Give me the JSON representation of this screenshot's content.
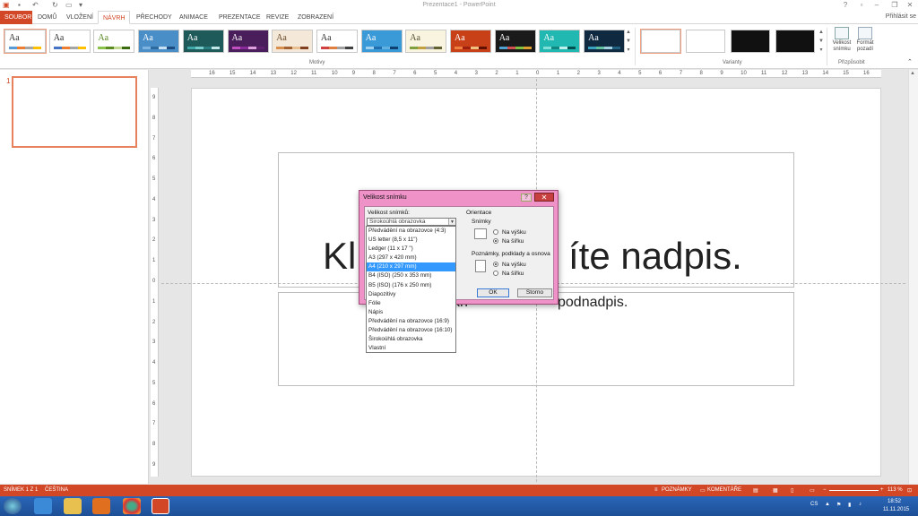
{
  "window": {
    "title": "Prezentace1 - PowerPoint",
    "sign_in": "Přihlásit se",
    "minimize": "–",
    "restore": "❐",
    "close": "✕",
    "help": "?"
  },
  "quick_access": [
    "save-icon",
    "undo-icon",
    "redo-icon",
    "start-from-beginning-icon",
    "customize-icon"
  ],
  "tabs": [
    "SOUBOR",
    "DOMŮ",
    "VLOŽENÍ",
    "NÁVRH",
    "PŘECHODY",
    "ANIMACE",
    "PREZENTACE",
    "REVIZE",
    "ZOBRAZENÍ"
  ],
  "active_tab": "NÁVRH",
  "ribbon": {
    "themes_label": "Motivy",
    "theme_glyph": "Aa",
    "variants_label": "Varianty",
    "customize_label": "Přizpůsobit",
    "slide_size_button": "Velikost snímku",
    "format_background_button": "Formát pozadí",
    "themes": [
      {
        "bg": "#ffffff",
        "fg": "#333333",
        "stripes": [
          "#5b9bd5",
          "#ed7d31",
          "#a5a5a5",
          "#ffc000"
        ]
      },
      {
        "bg": "#ffffff",
        "fg": "#333333",
        "stripes": [
          "#4472c4",
          "#ed7d31",
          "#a5a5a5",
          "#ffc000"
        ]
      },
      {
        "bg": "#ffffff",
        "fg": "#5a8a20",
        "stripes": [
          "#8bc34a",
          "#5a8a20",
          "#c0d890",
          "#3a6a10"
        ]
      },
      {
        "bg": "#4a8ec8",
        "fg": "#ffffff",
        "stripes": [
          "#7fb3e0",
          "#2d6aa0",
          "#c8e0f4",
          "#1a4a80"
        ]
      },
      {
        "bg": "#1e5a5a",
        "fg": "#ffffff",
        "stripes": [
          "#3fa8a8",
          "#7cc",
          "#2a8080",
          "#c0e8e8"
        ]
      },
      {
        "bg": "#4a1e5a",
        "fg": "#ffffff",
        "stripes": [
          "#c050c0",
          "#8a2a9a",
          "#e0a0e0",
          "#602070"
        ]
      },
      {
        "bg": "#f4e8d8",
        "fg": "#6a4a2a",
        "stripes": [
          "#d89050",
          "#a06030",
          "#e8c090",
          "#804020"
        ]
      },
      {
        "bg": "#ffffff",
        "fg": "#333333",
        "stripes": [
          "#d04040",
          "#e08040",
          "#a0a0a0",
          "#404040"
        ]
      },
      {
        "bg": "#3a9ad8",
        "fg": "#ffffff",
        "stripes": [
          "#a0d0f0",
          "#2070b0",
          "#60b0e0",
          "#104070"
        ]
      },
      {
        "bg": "#f8f4e0",
        "fg": "#555533",
        "stripes": [
          "#80a040",
          "#c0a040",
          "#a0a0a0",
          "#606030"
        ]
      },
      {
        "bg": "#c84018",
        "fg": "#ffffff",
        "stripes": [
          "#f08040",
          "#a02010",
          "#f0c080",
          "#601000"
        ]
      },
      {
        "bg": "#1a1a1a",
        "fg": "#ffffff",
        "stripes": [
          "#50a0d0",
          "#d05050",
          "#80c040",
          "#e0a030"
        ]
      },
      {
        "bg": "#20b8b0",
        "fg": "#ffffff",
        "stripes": [
          "#80e0d8",
          "#108880",
          "#c0f0ec",
          "#005050"
        ]
      },
      {
        "bg": "#0f2a40",
        "fg": "#ffffff",
        "stripes": [
          "#3aa0c0",
          "#60c0a0",
          "#a0d0e0",
          "#206080"
        ]
      }
    ],
    "variants": [
      "#ffffff",
      "#ffffff",
      "#111111",
      "#111111"
    ]
  },
  "slide_panel": {
    "number": "1"
  },
  "ruler": {
    "h_marks": [
      "16",
      "15",
      "14",
      "13",
      "12",
      "11",
      "10",
      "9",
      "8",
      "7",
      "6",
      "5",
      "4",
      "3",
      "2",
      "1",
      "0",
      "1",
      "2",
      "3",
      "4",
      "5",
      "6",
      "7",
      "8",
      "9",
      "10",
      "11",
      "12",
      "13",
      "14",
      "15",
      "16"
    ],
    "v_marks": [
      "9",
      "8",
      "7",
      "6",
      "5",
      "4",
      "3",
      "2",
      "1",
      "0",
      "1",
      "2",
      "3",
      "4",
      "5",
      "6",
      "7",
      "8",
      "9"
    ]
  },
  "slide": {
    "title_start": "Kl",
    "title_end": "íte nadpis.",
    "subtitle_start": "kn",
    "subtitle_end": "podnadpis."
  },
  "dialog": {
    "title": "Velikost snímku",
    "size_label": "Velikost snímků:",
    "size_value": "Širokoúhlá obrazovka",
    "orientation_label": "Orientace",
    "slides_label": "Snímky",
    "portrait": "Na výšku",
    "landscape": "Na šířku",
    "notes_label": "Poznámky, podklady a osnova",
    "ok": "OK",
    "cancel": "Storno",
    "slides_orientation": "landscape",
    "notes_orientation": "portrait",
    "options": [
      "Předvádění na obrazovce (4:3)",
      "US letter (8,5 x 11\")",
      "Ledger (11 x 17 \")",
      "A3 (297 x 420 mm)",
      "A4 (210 x 297 mm)",
      "B4 (ISO) (250 x 353 mm)",
      "B5 (ISO) (176 x 250 mm)",
      "Diapozitivy",
      "Fólie",
      "Nápis",
      "Předvádění na obrazovce (16:9)",
      "Předvádění na obrazovce (16:10)",
      "Širokoúhlá obrazovka",
      "Vlastní"
    ],
    "highlighted_option": "A4 (210 x 297 mm)"
  },
  "status": {
    "slide": "SNÍMEK 1 Z 1",
    "language": "ČEŠTINA",
    "notes": "POZNÁMKY",
    "comments": "KOMENTÁŘE",
    "zoom": "113 %"
  },
  "taskbar": {
    "language": "CS",
    "time": "18:52",
    "date": "11.11.2015"
  }
}
